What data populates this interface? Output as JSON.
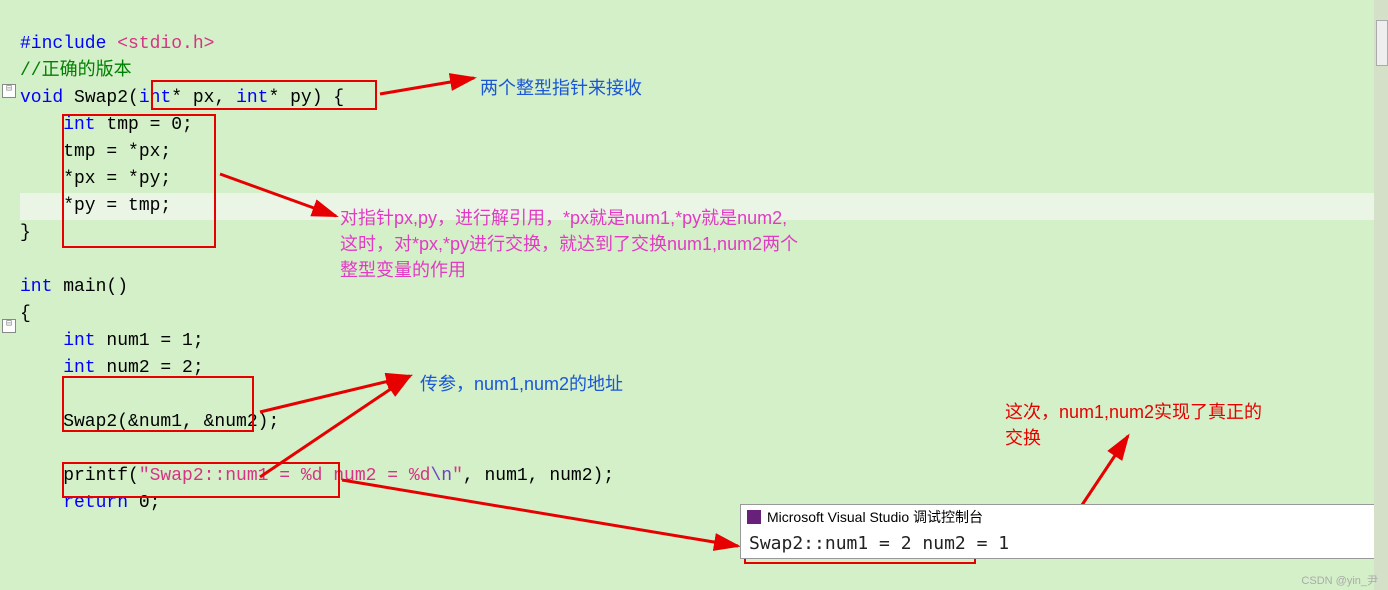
{
  "code": {
    "include": "#include",
    "include_lt": " <",
    "include_header": "stdio.h",
    "include_gt": ">",
    "comment": "//正确的版本",
    "void": "void",
    "swap2_decl": " Swap2(",
    "intstar1": "int",
    "px_star": "* px, ",
    "intstar2": "int",
    "py_star": "* py",
    "paren_brace": ") {",
    "int_tmp": "    int",
    "tmp_eq": " tmp = 0;",
    "tmp_px": "    tmp = *px;",
    "px_py": "    *px = *py;",
    "py_tmp": "    *py = tmp;",
    "close1": "}",
    "int_main": "int",
    "main_decl": " main()",
    "open_brace": "{",
    "int_num1": "    int",
    "num1_assign": " num1 = 1;",
    "int_num2": "    int",
    "num2_assign": " num2 = 2;",
    "swap2_call": "    Swap2(&num1, &num2);",
    "printf_start": "    printf(",
    "printf_str1": "\"Swap2::num1 = %d num2 = %d",
    "printf_esc": "\\n",
    "printf_str2": "\"",
    "printf_args": ", num1, num2);",
    "return_kw": "    return",
    "return_val": " 0;"
  },
  "annotations": {
    "a1": "两个整型指针来接收",
    "a2_l1": "对指针px,py，进行解引用，*px就是num1,*py就是num2,",
    "a2_l2": "这时，对*px,*py进行交换，就达到了交换num1,num2两个",
    "a2_l3": "整型变量的作用",
    "a3": "传参，num1,num2的地址",
    "a4_l1": "这次，num1,num2实现了真正的",
    "a4_l2": "交换"
  },
  "console": {
    "title": "Microsoft Visual Studio 调试控制台",
    "output": "Swap2::num1 = 2 num2 = 1"
  },
  "watermark": "CSDN @yin_尹",
  "fold": "⊟"
}
